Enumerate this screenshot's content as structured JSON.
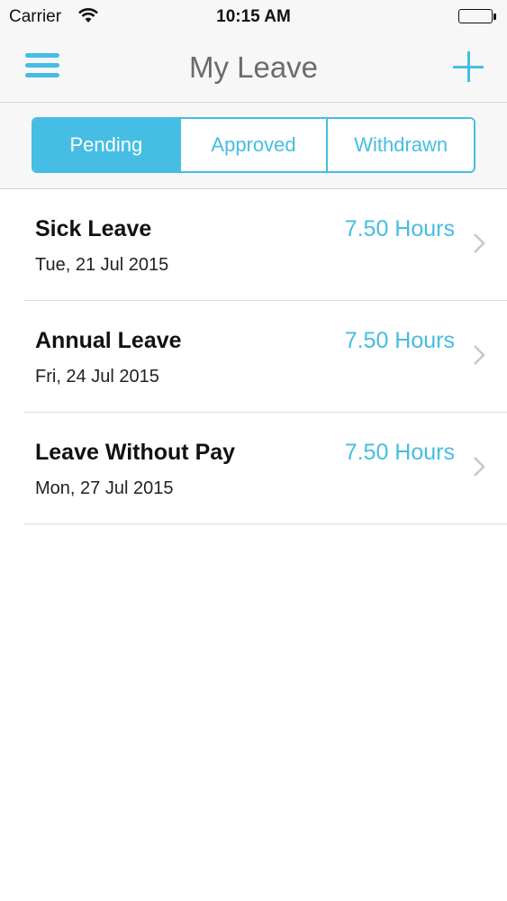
{
  "status_bar": {
    "carrier": "Carrier",
    "time": "10:15 AM"
  },
  "nav": {
    "title": "My Leave",
    "menu_icon": "hamburger-menu-icon",
    "add_icon": "plus-icon"
  },
  "tabs": [
    {
      "label": "Pending",
      "selected": true
    },
    {
      "label": "Approved",
      "selected": false
    },
    {
      "label": "Withdrawn",
      "selected": false
    }
  ],
  "leave_items": [
    {
      "type": "Sick Leave",
      "date": "Tue, 21 Jul 2015",
      "hours": "7.50 Hours"
    },
    {
      "type": "Annual Leave",
      "date": "Fri, 24 Jul 2015",
      "hours": "7.50 Hours"
    },
    {
      "type": "Leave Without Pay",
      "date": "Mon, 27 Jul 2015",
      "hours": "7.50 Hours"
    }
  ],
  "colors": {
    "accent": "#45bde4",
    "bar_background": "#f7f7f8",
    "title_gray": "#6b6b6b",
    "chevron_gray": "#c7c7cc"
  }
}
